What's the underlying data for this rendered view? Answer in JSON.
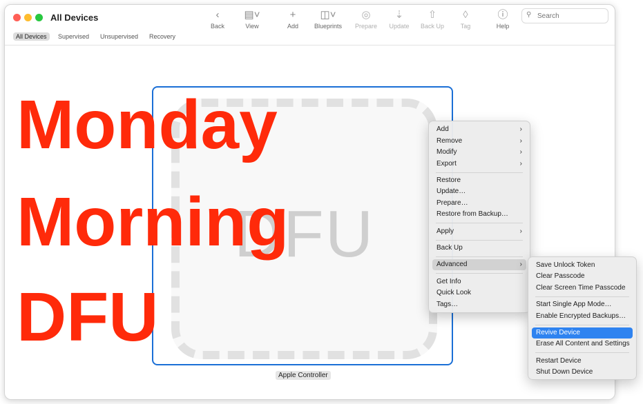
{
  "window": {
    "title": "All Devices"
  },
  "toolbar": {
    "items": [
      {
        "label": "Back",
        "icon": "chevron-left-icon"
      },
      {
        "label": "View",
        "icon": "view-icon"
      },
      {
        "label": "Add",
        "icon": "plus-icon"
      },
      {
        "label": "Blueprints",
        "icon": "blueprints-icon"
      },
      {
        "label": "Prepare",
        "icon": "prepare-icon"
      },
      {
        "label": "Update",
        "icon": "update-icon"
      },
      {
        "label": "Back Up",
        "icon": "backup-icon"
      },
      {
        "label": "Tag",
        "icon": "tag-icon"
      },
      {
        "label": "Help",
        "icon": "help-icon"
      }
    ]
  },
  "search": {
    "placeholder": "Search"
  },
  "filters": [
    "All Devices",
    "Supervised",
    "Unsupervised",
    "Recovery"
  ],
  "device": {
    "tile_label": "DFU",
    "name": "Apple Controller"
  },
  "overlay": {
    "line1": "Monday",
    "line2": "Morning",
    "line3": "DFU",
    "color": "#ff2a0a"
  },
  "context_menu": {
    "items": [
      "Add",
      "Remove",
      "Modify",
      "Export",
      "Restore",
      "Update…",
      "Prepare…",
      "Restore from Backup…",
      "Apply",
      "Back Up",
      "Advanced",
      "Get Info",
      "Quick Look",
      "Tags…"
    ]
  },
  "advanced_menu": {
    "items": [
      "Save Unlock Token",
      "Clear Passcode",
      "Clear Screen Time Passcode",
      "Start Single App Mode…",
      "Enable Encrypted Backups…",
      "Revive Device",
      "Erase All Content and Settings",
      "Restart Device",
      "Shut Down Device"
    ]
  },
  "colors": {
    "accent": "#2f83f0",
    "selection_border": "#1a6fd6"
  }
}
